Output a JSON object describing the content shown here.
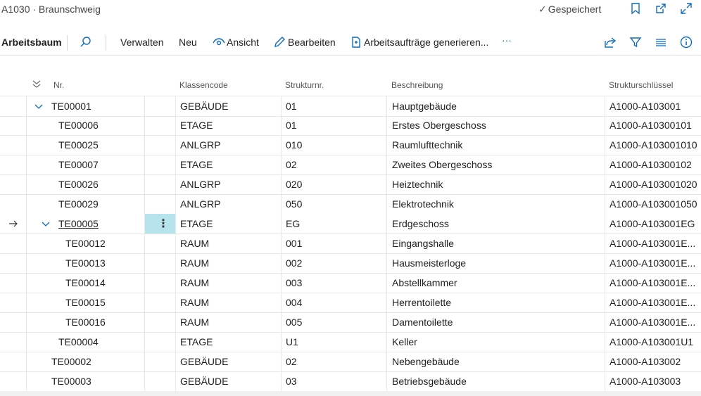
{
  "header": {
    "title": "A1030 · Braunschweig",
    "saved_check": "✓",
    "saved_label": "Gespeichert"
  },
  "actions": {
    "page_name": "Arbeitsbaum",
    "manage": "Verwalten",
    "new": "Neu",
    "view": "Ansicht",
    "edit": "Bearbeiten",
    "generate": "Arbeitsaufträge generieren...",
    "more": "···"
  },
  "columns": {
    "nr": "Nr.",
    "class_code": "Klassencode",
    "structure_no": "Strukturnr.",
    "description": "Beschreibung",
    "structure_key": "Strukturschlüssel"
  },
  "rows": [
    {
      "nr": "TE00001",
      "level": 0,
      "expanded": true,
      "class_code": "GEBÄUDE",
      "structure_no": "01",
      "description": "Hauptgebäude",
      "structure_key": "A1000-A103001"
    },
    {
      "nr": "TE00006",
      "level": 1,
      "class_code": "ETAGE",
      "structure_no": "01",
      "description": "Erstes Obergeschoss",
      "structure_key": "A1000-A10300101"
    },
    {
      "nr": "TE00025",
      "level": 1,
      "class_code": "ANLGRP",
      "structure_no": "010",
      "description": "Raumlufttechnik",
      "structure_key": "A1000-A103001010"
    },
    {
      "nr": "TE00007",
      "level": 1,
      "class_code": "ETAGE",
      "structure_no": "02",
      "description": "Zweites Obergeschoss",
      "structure_key": "A1000-A10300102"
    },
    {
      "nr": "TE00026",
      "level": 1,
      "class_code": "ANLGRP",
      "structure_no": "020",
      "description": "Heiztechnik",
      "structure_key": "A1000-A103001020"
    },
    {
      "nr": "TE00029",
      "level": 1,
      "class_code": "ANLGRP",
      "structure_no": "050",
      "description": "Elektrotechnik",
      "structure_key": "A1000-A103001050"
    },
    {
      "nr": "TE00005",
      "level": 1,
      "expanded": true,
      "selected": true,
      "class_code": "ETAGE",
      "structure_no": "EG",
      "description": "Erdgeschoss",
      "structure_key": "A1000-A103001EG"
    },
    {
      "nr": "TE00012",
      "level": 2,
      "class_code": "RAUM",
      "structure_no": "001",
      "description": "Eingangshalle",
      "structure_key": "A1000-A103001E..."
    },
    {
      "nr": "TE00013",
      "level": 2,
      "class_code": "RAUM",
      "structure_no": "002",
      "description": "Hausmeisterloge",
      "structure_key": "A1000-A103001E..."
    },
    {
      "nr": "TE00014",
      "level": 2,
      "class_code": "RAUM",
      "structure_no": "003",
      "description": "Abstellkammer",
      "structure_key": "A1000-A103001E..."
    },
    {
      "nr": "TE00015",
      "level": 2,
      "class_code": "RAUM",
      "structure_no": "004",
      "description": "Herrentoilette",
      "structure_key": "A1000-A103001E..."
    },
    {
      "nr": "TE00016",
      "level": 2,
      "class_code": "RAUM",
      "structure_no": "005",
      "description": "Damentoilette",
      "structure_key": "A1000-A103001E..."
    },
    {
      "nr": "TE00004",
      "level": 1,
      "class_code": "ETAGE",
      "structure_no": "U1",
      "description": "Keller",
      "structure_key": "A1000-A103001U1"
    },
    {
      "nr": "TE00002",
      "level": 0,
      "class_code": "GEBÄUDE",
      "structure_no": "02",
      "description": "Nebengebäude",
      "structure_key": "A1000-A103002"
    },
    {
      "nr": "TE00003",
      "level": 0,
      "class_code": "GEBÄUDE",
      "structure_no": "03",
      "description": "Betriebsgebäude",
      "structure_key": "A1000-A103003"
    }
  ],
  "row_menu_glyph": "⋮",
  "colors": {
    "accent": "#0f6cbd",
    "selected_menu_bg": "#b7e4ec"
  }
}
